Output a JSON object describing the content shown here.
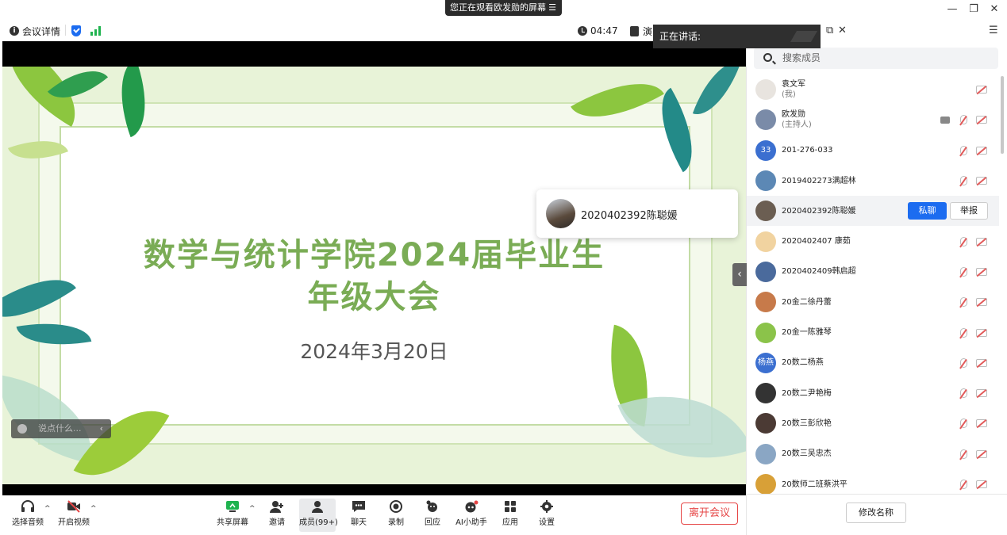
{
  "share_banner": {
    "text": "您正在观看欧发勋的屏幕"
  },
  "infobar": {
    "meeting_details": "会议详情",
    "timer": "04:47",
    "doc_label": "演"
  },
  "speaking": {
    "label": "正在讲话:"
  },
  "slide": {
    "title_line1": "数学与统计学院2024届毕业生",
    "title_line2": "年级大会",
    "date": "2024年3月20日"
  },
  "speaker_popup": {
    "name": "2020402392陈聪媛"
  },
  "chat_input": {
    "placeholder": "说点什么..."
  },
  "search": {
    "placeholder": "搜索成员"
  },
  "members": [
    {
      "name": "袁文军",
      "sub": "(我)",
      "avatar_color": "#e8e4df",
      "avatar_text": ""
    },
    {
      "name": "欧发勋",
      "sub": "(主持人)",
      "avatar_color": "#7a8ba8",
      "avatar_text": ""
    },
    {
      "name": "201-276-033",
      "sub": "",
      "avatar_color": "#3b6fd0",
      "avatar_text": "33"
    },
    {
      "name": "2019402273满超林",
      "sub": "",
      "avatar_color": "#5c88b5",
      "avatar_text": ""
    },
    {
      "name": "2020402392陈聪媛",
      "sub": "",
      "avatar_color": "#6b5e52",
      "avatar_text": ""
    },
    {
      "name": "2020402407 康茹",
      "sub": "",
      "avatar_color": "#f1d3a0",
      "avatar_text": ""
    },
    {
      "name": "2020402409韩启超",
      "sub": "",
      "avatar_color": "#4a6a9c",
      "avatar_text": ""
    },
    {
      "name": "20金二徐丹蕾",
      "sub": "",
      "avatar_color": "#c77a4a",
      "avatar_text": ""
    },
    {
      "name": "20金一陈雅琴",
      "sub": "",
      "avatar_color": "#8bc34a",
      "avatar_text": ""
    },
    {
      "name": "20数二杨燕",
      "sub": "",
      "avatar_color": "#3b6fd0",
      "avatar_text": "杨燕"
    },
    {
      "name": "20数二尹艳梅",
      "sub": "",
      "avatar_color": "#333333",
      "avatar_text": ""
    },
    {
      "name": "20数三彭欣艳",
      "sub": "",
      "avatar_color": "#4b3a34",
      "avatar_text": ""
    },
    {
      "name": "20数三吴忠杰",
      "sub": "",
      "avatar_color": "#8aa6c4",
      "avatar_text": ""
    },
    {
      "name": "20数师二班蔡洪平",
      "sub": "",
      "avatar_color": "#d8a037",
      "avatar_text": ""
    }
  ],
  "member_actions": {
    "private_chat": "私聊",
    "report": "举报"
  },
  "rename_button": "修改名称",
  "toolbar": {
    "audio": "选择音频",
    "video": "开启视频",
    "share": "共享屏幕",
    "invite": "邀请",
    "members": "成员(99+)",
    "chat": "聊天",
    "record": "录制",
    "reactions": "回应",
    "ai": "AI小助手",
    "apps": "应用",
    "settings": "设置",
    "leave": "离开会议"
  },
  "colors": {
    "accent": "#1c6cf0",
    "leave": "#e64545",
    "slide_title": "#7aac55"
  }
}
